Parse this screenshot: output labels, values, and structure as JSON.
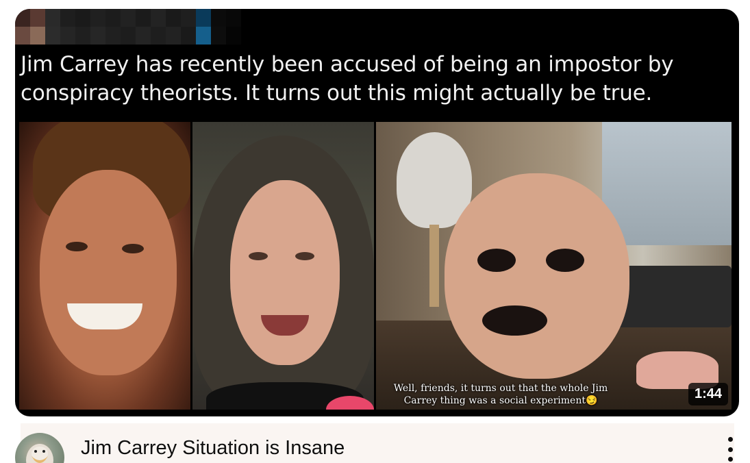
{
  "thumbnail": {
    "caption": "Jim Carrey has recently been accused of being an impostor by conspiracy theorists. It turns out this might actually be true.",
    "overlay_subtitle_line1": "Well, friends, it turns out that the whole Jim",
    "overlay_subtitle_line2": "Carrey thing was a social experiment😏",
    "duration": "1:44"
  },
  "video": {
    "title": "Jim Carrey Situation is Insane",
    "more_actions_icon": "kebab-vertical-icon",
    "channel_avatar_icon": "channel-avatar"
  },
  "colors": {
    "thumbnail_bg": "#000000",
    "caption_text": "#f2f2f2",
    "title_text": "#0f0f0f",
    "info_bg": "#faf5f2",
    "duration_badge_bg": "#000000c7"
  }
}
